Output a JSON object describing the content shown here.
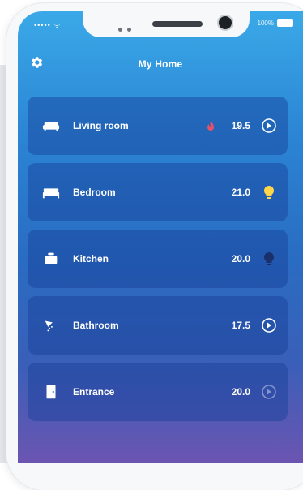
{
  "status_bar": {
    "signal": "••••• ᯤ",
    "battery_percent": "100%"
  },
  "header": {
    "title": "My Home",
    "settings_icon": "gear-icon"
  },
  "rooms": [
    {
      "name": "Living room",
      "temperature": "19.5",
      "icon": "sofa-icon",
      "status_icon": "play-circle-icon",
      "extra_icon": "flame-icon",
      "flame_color": "#e8506a"
    },
    {
      "name": "Bedroom",
      "temperature": "21.0",
      "icon": "bed-icon",
      "status_icon": "lightbulb-icon",
      "bulb_color": "#ffd54a"
    },
    {
      "name": "Kitchen",
      "temperature": "20.0",
      "icon": "pot-icon",
      "status_icon": "lightbulb-off-icon",
      "bulb_color": "#1b2f6a"
    },
    {
      "name": "Bathroom",
      "temperature": "17.5",
      "icon": "shower-icon",
      "status_icon": "play-circle-icon"
    },
    {
      "name": "Entrance",
      "temperature": "20.0",
      "icon": "door-icon",
      "status_icon": "play-circle-dim-icon"
    }
  ]
}
